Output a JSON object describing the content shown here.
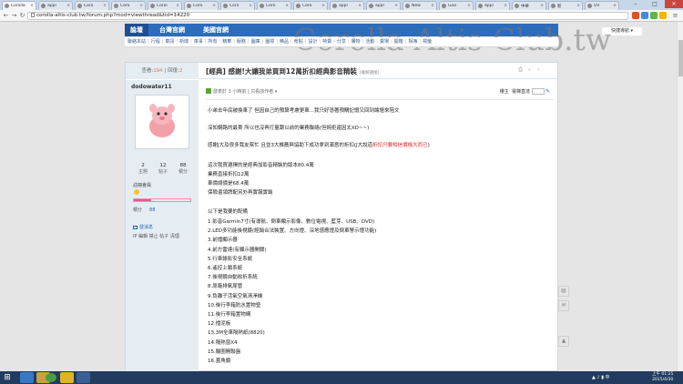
{
  "browser": {
    "tabs": [
      {
        "label": "Corolla"
      },
      {
        "label": "appl"
      },
      {
        "label": "Coro"
      },
      {
        "label": "Coro"
      },
      {
        "label": "Corol"
      },
      {
        "label": "Coro"
      },
      {
        "label": "Coro"
      },
      {
        "label": "Coro"
      },
      {
        "label": "Coro"
      },
      {
        "label": "appl"
      },
      {
        "label": "appl"
      },
      {
        "label": "New"
      },
      {
        "label": "Goo"
      },
      {
        "label": "appl"
      },
      {
        "label": "中華"
      },
      {
        "label": "新"
      },
      {
        "label": "UV"
      }
    ],
    "url": "corolla-altis-club.tw/forum.php?mod=viewthread&tid=14220"
  },
  "site": {
    "nav_tabs": [
      "論壇",
      "台灣官網",
      "美國官網"
    ],
    "quick_nav": "快捷導航 ▾",
    "watermark": "Corolla-Altis-Club.tw",
    "subnav": [
      "聯絡本站",
      "行程",
      "車訊",
      "新聞",
      "車事",
      "所有",
      "精華",
      "服務",
      "圖庫",
      "圖標",
      "精品",
      "贈點",
      "設計",
      "特賣",
      "分享",
      "購物",
      "活動",
      "賣場",
      "開箱",
      "相簿",
      "標籤"
    ]
  },
  "thread": {
    "views_label": "查看:",
    "views": "194",
    "sep": " | ",
    "replies_label": "回復:",
    "replies": "2",
    "title": "[經典] 感謝!大讓我弟買到12萬折扣經典影音精裝",
    "copy_link": "[複製鏈接]"
  },
  "author": {
    "name": "dodowater11",
    "stats": [
      {
        "n": "2",
        "l": "主題"
      },
      {
        "n": "12",
        "l": "帖子"
      },
      {
        "n": "88",
        "l": "積分"
      }
    ],
    "rank": "註冊會員",
    "progress": 0.3,
    "score_label": "積分",
    "score_value": "88",
    "pm": "發消息",
    "admin": "IP 編輯 禁止 帖子 清理"
  },
  "post_meta": {
    "text": "發表於 3 小時前 | 只看該作者 ▾",
    "floor_label": "樓主",
    "jump_label": "電梯直達"
  },
  "post_body": {
    "p1": "小弟去年底被換車了 但因自己的預算考慮更車...我只好憑著預購記憶又回到論壇來陪文",
    "p2": "深知網路的最貴 所以也沒再打量跟以前的業務聯絡(但婉拒還因太XD~~)",
    "p3a": "感謝J大及很多我友幫忙  且並3大推薦與協助下成功拿到滿意的折扣(J大說道",
    "p3b": "折扣只要相信價格大而已",
    "p3c": ")",
    "p4": "這次我買選擇的是經典加影音精裝的版本80.4萬",
    "p5": "業務直接折扣12萬",
    "p6": "車價總價是68.4萬",
    "p7": "保險還領牌配另外再實報實銷",
    "p8": "以下是我要的配備",
    "items": [
      "1.影音Garmin7寸(有導航、倒車顯示影像、數位電視、藍芽、USB、DVD)",
      "2.LED多功能後視鏡(經銷合法裝置、方向燈、深地感應燈及倒車警示燈功能)",
      "3.前擋顯示器",
      "4.前方雷達(有顯示器開關)",
      "5.行車錄影安全系統",
      "6.遙控上鎖系統",
      "7.後視鏡自動收折系統",
      "8.原廠排氣尾管",
      "9.負離子活氧空氣清淨機",
      "10.後行李箱防水置物墊",
      "11.後行李箱置物網",
      "12.擋泥板",
      "13.3M全車隔熱紙(8820)",
      "14.隔熱窗X4",
      "15.輪圈開聯盤",
      "16.蓋角鏡"
    ]
  },
  "taskbar": {
    "tray": "▲  ♪  ▮ 中",
    "time": "上午 01:25",
    "date": "2015/4/30"
  }
}
